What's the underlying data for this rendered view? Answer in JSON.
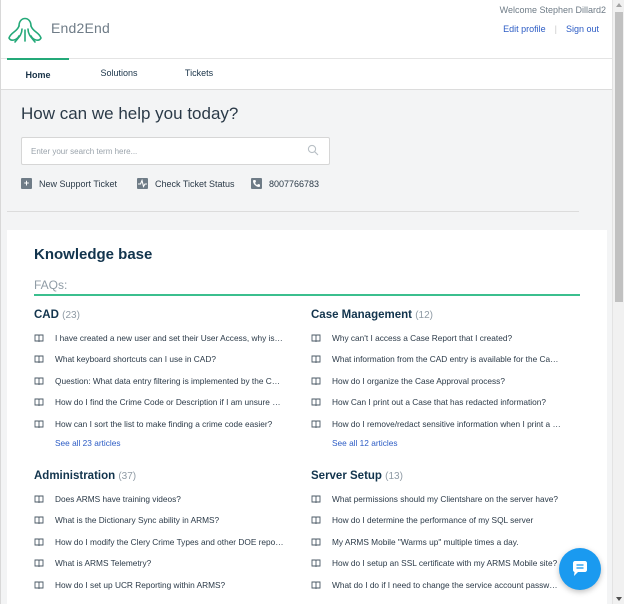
{
  "brand": {
    "name": "End2End",
    "accent": "#24a979",
    "link": "#2c5cc5"
  },
  "user": {
    "welcome": "Welcome Stephen Dillard2",
    "edit_profile": "Edit profile",
    "sign_out": "Sign out"
  },
  "nav": {
    "tabs": [
      {
        "label": "Home",
        "active": true
      },
      {
        "label": "Solutions"
      },
      {
        "label": "Tickets"
      }
    ]
  },
  "hero": {
    "title": "How can we help you today?",
    "search_placeholder": "Enter your search term here...",
    "quick_links": [
      {
        "label": "New Support Ticket",
        "icon": "plus-icon"
      },
      {
        "label": "Check Ticket Status",
        "icon": "activity-icon"
      },
      {
        "label": "8007766783",
        "icon": "phone-icon"
      }
    ]
  },
  "kb": {
    "title": "Knowledge base",
    "faq_label": "FAQs:",
    "sections": [
      {
        "name": "CAD",
        "count": "(23)",
        "articles": [
          "I have created a new user and set their User Access, why is the user not able to log in?",
          "What keyboard shortcuts can I use in CAD?",
          "Question: What data entry filtering is implemented by the CAD system?",
          "How do I find the Crime Code or Description if I am unsure of it?",
          "How can I sort the list to make finding a crime code easier?"
        ],
        "see_all": "See all 23 articles"
      },
      {
        "name": "Case Management",
        "count": "(12)",
        "articles": [
          "Why can't I access a Case Report that I created?",
          "What information from the CAD entry is available for the Case Report?",
          "How do I organize the Case Approval process?",
          "How Can I print out a Case that has redacted information?",
          "How do I remove/redact sensitive information when I print a report?"
        ],
        "see_all": "See all 12 articles"
      },
      {
        "name": "Administration",
        "count": "(37)",
        "articles": [
          "Does ARMS have training videos?",
          "What is the Dictionary Sync ability in ARMS?",
          "How do I modify the Clery Crime Types and other DOE reporting fields?",
          "What is ARMS Telemetry?",
          "How do I set up UCR Reporting within ARMS?"
        ]
      },
      {
        "name": "Server Setup",
        "count": "(13)",
        "articles": [
          "What permissions should my Clientshare on the server have?",
          "How do I determine the performance of my SQL server",
          "My ARMS Mobile \"Warms up\" multiple times a day.",
          "How do I setup an SSL certificate with my ARMS Mobile site?",
          "What do I do if I need to change the service account password?"
        ]
      }
    ]
  }
}
